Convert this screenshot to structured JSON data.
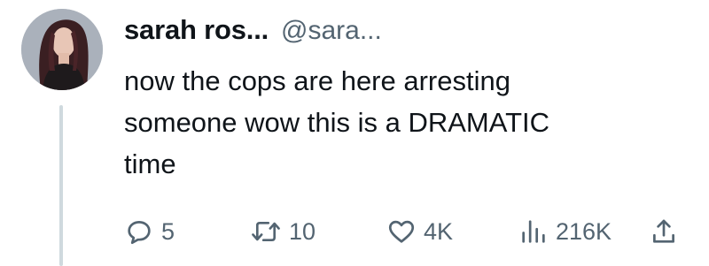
{
  "author": {
    "display_name": "sarah ros...",
    "handle": "@sara..."
  },
  "tweet": {
    "text_lines": [
      "now the cops are here arresting",
      "someone wow this is a DRAMATIC",
      "time"
    ]
  },
  "actions": {
    "replies": "5",
    "retweets": "10",
    "likes": "4K",
    "views": "216K"
  },
  "icons": {
    "reply": "speech-bubble-icon",
    "retweet": "retweet-arrows-icon",
    "like": "heart-outline-icon",
    "views": "bar-chart-icon",
    "share": "share-upload-icon"
  },
  "colors": {
    "text": "#0f1419",
    "secondary": "#536471",
    "thread_line": "#cfd9de"
  }
}
